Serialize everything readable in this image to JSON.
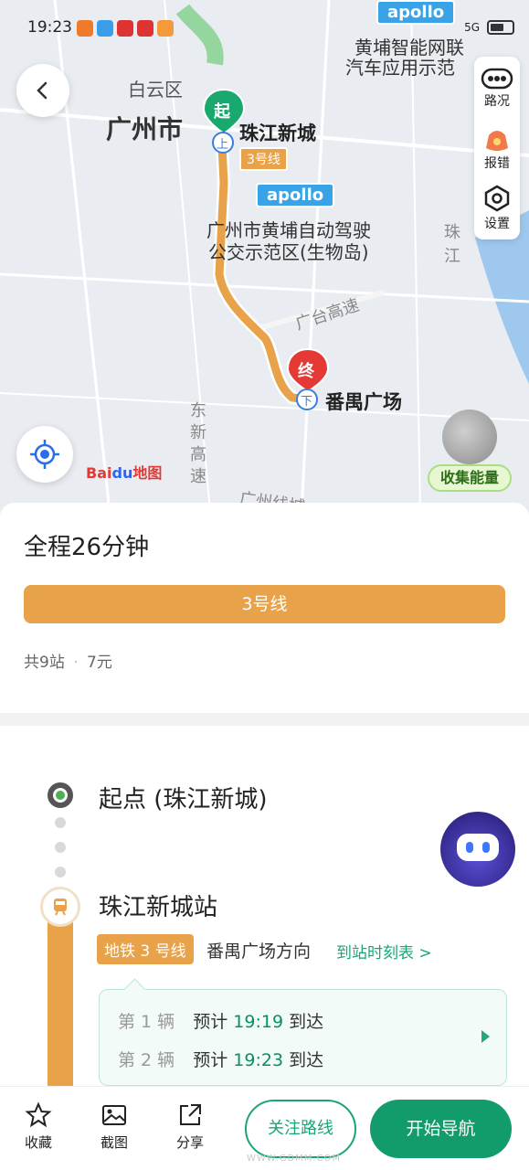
{
  "status_bar": {
    "time": "19:23",
    "network": "5G"
  },
  "map": {
    "district_baiyun": "白云区",
    "city": "广州市",
    "start_marker": "起",
    "start_station": "珠江新城",
    "line_label": "3号线",
    "end_marker": "终",
    "end_station": "番禺广场",
    "board_marker": "上",
    "alight_marker": "下",
    "apollo_1": "apollo",
    "apollo_2": "apollo",
    "huangpu_top_1": "黄埔智能网联",
    "huangpu_top_2": "汽车应用示范",
    "huangpu_mid_1": "广州市黄埔自动驾驶",
    "huangpu_mid_2": "公交示范区(生物岛)",
    "road_guangtai": "广台高速",
    "road_dongxin": "东新高速",
    "road_bottom": "广州线城",
    "river": "珠江",
    "baidu_logo_a": "Bai",
    "baidu_logo_b": "du",
    "baidu_logo_c": "地图",
    "collect_energy": "收集能量"
  },
  "side_tools": {
    "traffic": "路况",
    "report": "报错",
    "settings": "设置"
  },
  "summary": {
    "total": "全程26分钟",
    "line": "3号线",
    "stops": "共9站",
    "price": "7元"
  },
  "route": {
    "start_label": "起点 (珠江新城)",
    "station": "珠江新城站",
    "line_tag": "地铁 3 号线",
    "direction": "番禺广场方向",
    "timetable": "到站时刻表 >",
    "arrivals": [
      {
        "n": "第 1 辆",
        "pre": "预计",
        "time": "19:19",
        "post": "到达"
      },
      {
        "n": "第 2 辆",
        "pre": "预计",
        "time": "19:23",
        "post": "到达"
      }
    ]
  },
  "bottom_bar": {
    "favorite": "收藏",
    "screenshot": "截图",
    "share": "分享",
    "follow": "关注路线",
    "navigate": "开始导航",
    "watermark": "WWW.GDMM.COM"
  }
}
